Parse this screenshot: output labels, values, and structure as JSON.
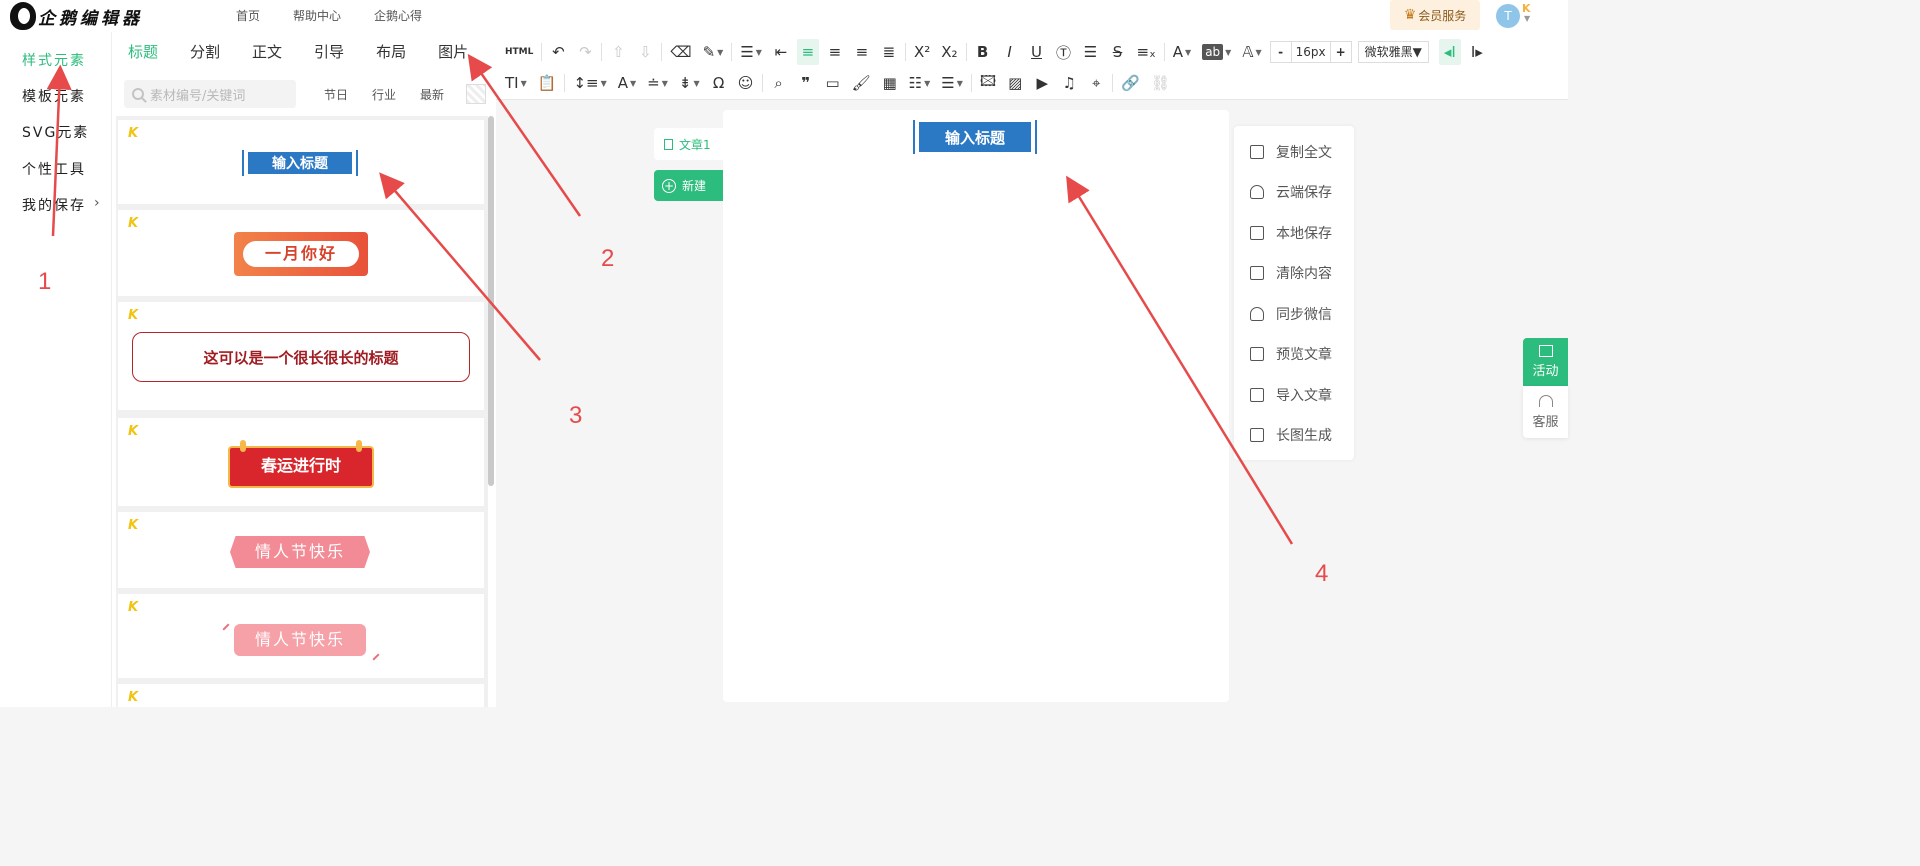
{
  "header": {
    "logo_text": "企鹅编辑器",
    "nav": [
      "首页",
      "帮助中心",
      "企鹅心得"
    ],
    "vip_label": "会员服务",
    "avatar_letter": "T"
  },
  "sidebar": {
    "items": [
      {
        "label": "样式元素",
        "active": true
      },
      {
        "label": "模板元素",
        "active": false
      },
      {
        "label": "SVG元素",
        "active": false
      },
      {
        "label": "个性工具",
        "active": false
      },
      {
        "label": "我的保存",
        "active": false
      }
    ]
  },
  "panel": {
    "tabs": [
      {
        "label": "标题",
        "active": true
      },
      {
        "label": "分割",
        "active": false
      },
      {
        "label": "正文",
        "active": false
      },
      {
        "label": "引导",
        "active": false
      },
      {
        "label": "布局",
        "active": false
      },
      {
        "label": "图片",
        "active": false
      }
    ],
    "search_placeholder": "素材编号/关键词",
    "filters": [
      "节日",
      "行业",
      "最新"
    ],
    "cards": [
      "输入标题",
      "一月你好",
      "这可以是一个很长很长的标题",
      "春运进行时",
      "情人节快乐",
      "情人节快乐"
    ]
  },
  "toolbar": {
    "html_label": "HTML",
    "font_size": "16px",
    "font_family": "微软雅黑",
    "minus": "-",
    "plus": "+"
  },
  "editor": {
    "doc_tab": "文章1",
    "new_label": "新建",
    "heading": "输入标题"
  },
  "actions": [
    "复制全文",
    "云端保存",
    "本地保存",
    "清除内容",
    "同步微信",
    "预览文章",
    "导入文章",
    "长图生成"
  ],
  "float": {
    "activity": "活动",
    "service": "客服"
  },
  "annotations": [
    "1",
    "2",
    "3",
    "4"
  ],
  "colors": {
    "accent": "#2cbc7d",
    "title_blue": "#2b78c5",
    "annotation_red": "#e64a4a"
  }
}
